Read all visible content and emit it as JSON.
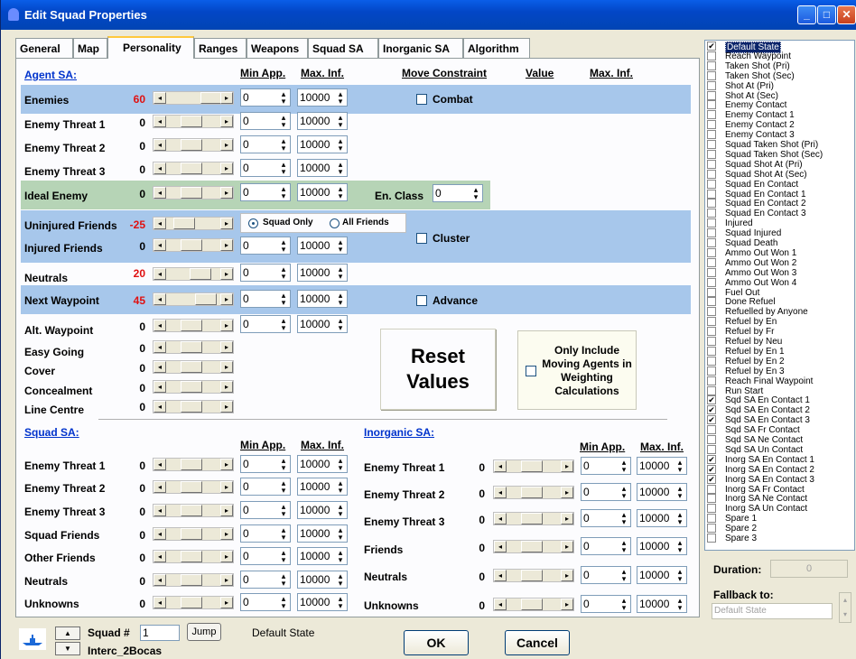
{
  "window": {
    "title": "Edit Squad Properties",
    "min": "_",
    "max": "□",
    "close": "✕"
  },
  "tabs": [
    "General",
    "Map",
    "Personality",
    "Ranges",
    "Weapons",
    "Squad SA",
    "Inorganic SA",
    "Algorithm"
  ],
  "active_tab": "Personality",
  "agent_sa": {
    "title": "Agent SA:",
    "col_min_app": "Min App.",
    "col_max_inf": "Max. Inf.",
    "col_move_constraint": "Move Constraint",
    "col_value": "Value",
    "col_max_inf2": "Max. Inf.",
    "rows": [
      {
        "label": "Enemies",
        "value": "60",
        "min": "0",
        "max": "10000"
      },
      {
        "label": "Enemy Threat 1",
        "value": "0",
        "min": "0",
        "max": "10000"
      },
      {
        "label": "Enemy Threat 2",
        "value": "0",
        "min": "0",
        "max": "10000"
      },
      {
        "label": "Enemy Threat 3",
        "value": "0",
        "min": "0",
        "max": "10000"
      },
      {
        "label": "Ideal Enemy",
        "value": "0",
        "min": "0",
        "max": "10000"
      },
      {
        "label": "Uninjured Friends",
        "value": "-25"
      },
      {
        "label": "Injured Friends",
        "value": "0",
        "min": "0",
        "max": "10000"
      },
      {
        "label": "Neutrals",
        "value": "20",
        "min": "0",
        "max": "10000"
      },
      {
        "label": "Next Waypoint",
        "value": "45",
        "min": "0",
        "max": "10000"
      },
      {
        "label": "Alt. Waypoint",
        "value": "0",
        "min": "0",
        "max": "10000"
      },
      {
        "label": "Easy Going",
        "value": "0"
      },
      {
        "label": "Cover",
        "value": "0"
      },
      {
        "label": "Concealment",
        "value": "0"
      },
      {
        "label": "Line Centre",
        "value": "0"
      }
    ],
    "combat": "Combat",
    "en_class_label": "En. Class",
    "en_class_value": "0",
    "squad_only": "Squad Only",
    "all_friends": "All Friends",
    "cluster": "Cluster",
    "advance": "Advance"
  },
  "reset_values": "Reset Values",
  "only_include": "Only Include Moving Agents in Weighting Calculations",
  "squad_sa": {
    "title": "Squad SA:",
    "col_min_app": "Min App.",
    "col_max_inf": "Max. Inf.",
    "rows": [
      {
        "label": "Enemy Threat 1",
        "value": "0",
        "min": "0",
        "max": "10000"
      },
      {
        "label": "Enemy Threat 2",
        "value": "0",
        "min": "0",
        "max": "10000"
      },
      {
        "label": "Enemy Threat 3",
        "value": "0",
        "min": "0",
        "max": "10000"
      },
      {
        "label": "Squad Friends",
        "value": "0",
        "min": "0",
        "max": "10000"
      },
      {
        "label": "Other Friends",
        "value": "0",
        "min": "0",
        "max": "10000"
      },
      {
        "label": "Neutrals",
        "value": "0",
        "min": "0",
        "max": "10000"
      },
      {
        "label": "Unknowns",
        "value": "0",
        "min": "0",
        "max": "10000"
      }
    ]
  },
  "inorganic_sa": {
    "title": "Inorganic SA:",
    "col_min_app": "Min App.",
    "col_max_inf": "Max. Inf.",
    "rows": [
      {
        "label": "Enemy Threat 1",
        "value": "0",
        "min": "0",
        "max": "10000"
      },
      {
        "label": "Enemy Threat 2",
        "value": "0",
        "min": "0",
        "max": "10000"
      },
      {
        "label": "Enemy Threat 3",
        "value": "0",
        "min": "0",
        "max": "10000"
      },
      {
        "label": "Friends",
        "value": "0",
        "min": "0",
        "max": "10000"
      },
      {
        "label": "Neutrals",
        "value": "0",
        "min": "0",
        "max": "10000"
      },
      {
        "label": "Unknowns",
        "value": "0",
        "min": "0",
        "max": "10000"
      }
    ]
  },
  "state_list": [
    {
      "label": "Default State",
      "checked": true,
      "selected": true
    },
    {
      "label": "Reach Waypoint",
      "checked": false
    },
    {
      "label": "Taken Shot (Pri)",
      "checked": false
    },
    {
      "label": "Taken Shot (Sec)",
      "checked": false
    },
    {
      "label": "Shot At (Pri)",
      "checked": false
    },
    {
      "label": "Shot At (Sec)",
      "checked": false
    },
    {
      "label": "Enemy Contact",
      "checked": false
    },
    {
      "label": "Enemy Contact 1",
      "checked": false
    },
    {
      "label": "Enemy Contact 2",
      "checked": false
    },
    {
      "label": "Enemy Contact 3",
      "checked": false
    },
    {
      "label": "Squad Taken Shot (Pri)",
      "checked": false
    },
    {
      "label": "Squad Taken Shot (Sec)",
      "checked": false
    },
    {
      "label": "Squad Shot At (Pri)",
      "checked": false
    },
    {
      "label": "Squad Shot At (Sec)",
      "checked": false
    },
    {
      "label": "Squad En Contact",
      "checked": false
    },
    {
      "label": "Squad En Contact 1",
      "checked": false
    },
    {
      "label": "Squad En Contact 2",
      "checked": false
    },
    {
      "label": "Squad En Contact 3",
      "checked": false
    },
    {
      "label": "Injured",
      "checked": false
    },
    {
      "label": "Squad Injured",
      "checked": false
    },
    {
      "label": "Squad Death",
      "checked": false
    },
    {
      "label": "Ammo Out Won 1",
      "checked": false
    },
    {
      "label": "Ammo Out Won 2",
      "checked": false
    },
    {
      "label": "Ammo Out Won 3",
      "checked": false
    },
    {
      "label": "Ammo Out Won 4",
      "checked": false
    },
    {
      "label": "Fuel Out",
      "checked": false
    },
    {
      "label": "Done Refuel",
      "checked": false
    },
    {
      "label": "Refuelled by Anyone",
      "checked": false
    },
    {
      "label": "Refuel by En",
      "checked": false
    },
    {
      "label": "Refuel by Fr",
      "checked": false
    },
    {
      "label": "Refuel by Neu",
      "checked": false
    },
    {
      "label": "Refuel by En 1",
      "checked": false
    },
    {
      "label": "Refuel by En 2",
      "checked": false
    },
    {
      "label": "Refuel by En 3",
      "checked": false
    },
    {
      "label": "Reach Final Waypoint",
      "checked": false
    },
    {
      "label": "Run Start",
      "checked": false
    },
    {
      "label": "Sqd SA En Contact 1",
      "checked": true
    },
    {
      "label": "Sqd SA En Contact 2",
      "checked": true
    },
    {
      "label": "Sqd SA En Contact 3",
      "checked": true
    },
    {
      "label": "Sqd SA Fr Contact",
      "checked": false
    },
    {
      "label": "Sqd SA Ne Contact",
      "checked": false
    },
    {
      "label": "Sqd SA Un Contact",
      "checked": false
    },
    {
      "label": "Inorg SA En Contact 1",
      "checked": true
    },
    {
      "label": "Inorg SA En Contact 2",
      "checked": true
    },
    {
      "label": "Inorg SA En Contact 3",
      "checked": true
    },
    {
      "label": "Inorg SA Fr Contact",
      "checked": false
    },
    {
      "label": "Inorg SA Ne Contact",
      "checked": false
    },
    {
      "label": "Inorg SA Un Contact",
      "checked": false
    },
    {
      "label": "Spare 1",
      "checked": false
    },
    {
      "label": "Spare 2",
      "checked": false
    },
    {
      "label": "Spare 3",
      "checked": false
    }
  ],
  "duration": {
    "label": "Duration:",
    "value": "0"
  },
  "fallback": {
    "label": "Fallback to:",
    "value": "Default State"
  },
  "footer": {
    "squad_label": "Squad #",
    "squad_value": "1",
    "jump": "Jump",
    "state": "Default State",
    "squad_name": "Interc_2Bocas",
    "ok": "OK",
    "cancel": "Cancel"
  },
  "colors": {
    "blue_band": "#a7c7eb",
    "green_band": "#b6d4b6",
    "red_value": "#e01010",
    "link": "#0033cc"
  }
}
